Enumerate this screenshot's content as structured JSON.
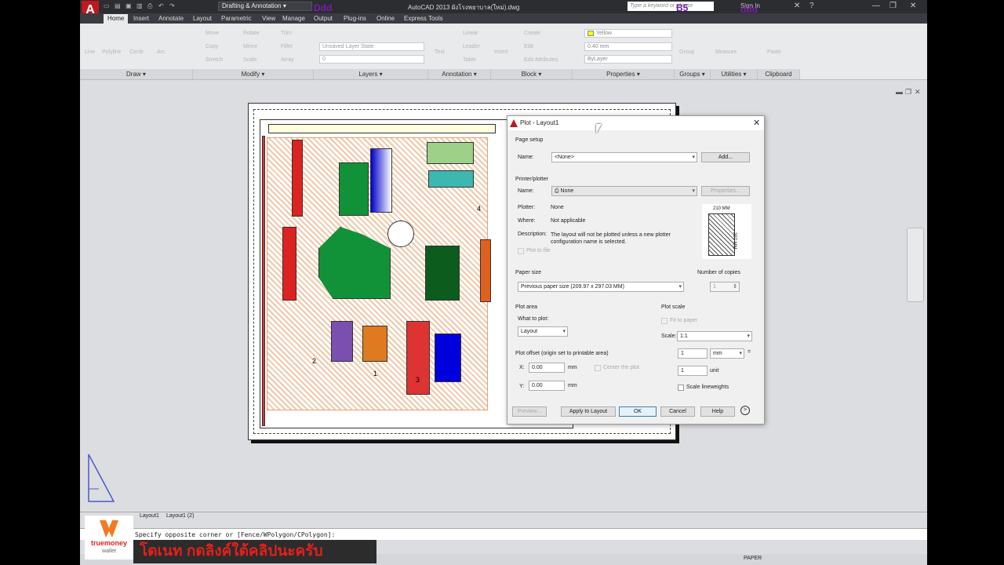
{
  "app": {
    "logo": "A",
    "workspace": "Drafting & Annotation",
    "title": "AutoCAD 2013   ผังโรงพยาบาล(ใหม่).dwg",
    "search_placeholder": "Type a keyword or phrase",
    "signin": "Sign In",
    "overlay_a": "Ddd",
    "overlay_b": "B5",
    "overlay_c": "ddd"
  },
  "tabs": [
    "Home",
    "Insert",
    "Annotate",
    "Layout",
    "Parametric",
    "View",
    "Manage",
    "Output",
    "Plug-ins",
    "Online",
    "Express Tools"
  ],
  "ribbon": {
    "draw_tools": [
      "Line",
      "Polyline",
      "Circle",
      "Arc"
    ],
    "modify_tools": [
      "Move",
      "Rotate",
      "Trim",
      "Copy",
      "Mirror",
      "Fillet",
      "Stretch",
      "Scale",
      "Array"
    ],
    "layer_state": "Unsaved Layer State",
    "layer_value": "0",
    "annotation_tools": [
      "Text",
      "Linear",
      "Leader",
      "Table"
    ],
    "block_tools": [
      "Insert",
      "Create",
      "Edit",
      "Edit Attributes"
    ],
    "color_value": "Yellow",
    "lineweight_value": "0.40 mm",
    "linetype_value": "ByLayer",
    "group_tools": [
      "Group"
    ],
    "utility_tools": [
      "Measure"
    ],
    "clipboard_tools": [
      "Paste"
    ],
    "panels": [
      "Draw",
      "Modify",
      "Layers",
      "Annotation",
      "Block",
      "Properties",
      "Groups",
      "Utilities",
      "Clipboard"
    ]
  },
  "dialog": {
    "title": "Plot - Layout1",
    "page_setup_label": "Page setup",
    "name_label": "Name:",
    "page_setup_name": "<None>",
    "add_button": "Add...",
    "printer_label": "Printer/plotter",
    "printer_name_label": "Name:",
    "printer_name": "None",
    "properties_button": "Properties...",
    "plotter_label": "Plotter:",
    "plotter_value": "None",
    "where_label": "Where:",
    "where_value": "Not applicable",
    "description_label": "Description:",
    "description_value": "The layout will not be plotted unless a new plotter configuration name is selected.",
    "plot_to_file": "Plot to file",
    "paper_width": "210 MM",
    "paper_height": "297 MM",
    "paper_size_label": "Paper size",
    "paper_size_value": "Previous paper size (209.97 x 297.03 MM)",
    "copies_label": "Number of copies",
    "copies_value": "1",
    "plot_area_label": "Plot area",
    "what_to_plot_label": "What to plot:",
    "what_to_plot_value": "Layout",
    "plot_scale_label": "Plot scale",
    "fit_to_paper": "Fit to paper",
    "scale_label": "Scale:",
    "scale_value": "1:1",
    "scale_num": "1",
    "scale_unit": "mm",
    "scale_den": "1",
    "unit_label": "unit",
    "scale_lineweights": "Scale lineweights",
    "offset_label": "Plot offset (origin set to printable area)",
    "x_label": "X:",
    "x_value": "0.00",
    "x_unit": "mm",
    "center_plot": "Center the plot",
    "y_label": "Y:",
    "y_value": "0.00",
    "y_unit": "mm",
    "preview_button": "Preview...",
    "apply_button": "Apply to Layout",
    "ok_button": "OK",
    "cancel_button": "Cancel",
    "help_button": "Help",
    "more_button": ">"
  },
  "layout_tabs": [
    "Layout1",
    "Layout1 (2)"
  ],
  "command_line": "Specify opposite corner or [Fence/WPolygon/CPolygon]:",
  "status": {
    "paper": "PAPER"
  },
  "plan_labels": [
    "1",
    "2",
    "3",
    "4"
  ],
  "watermark": {
    "brand": "truemoney",
    "sub": "wallet"
  },
  "subtitle": "โดเนท กดลิงค์ใต้คลิปนะครับ",
  "colors": {
    "accent": "#c0181f",
    "titlebar": "#2b2d31",
    "ribbon": "#e9eaec"
  }
}
